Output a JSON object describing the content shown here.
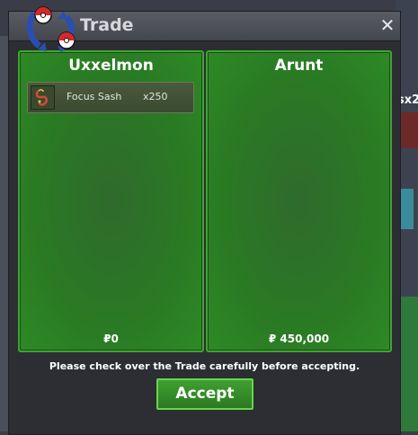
{
  "window": {
    "title": "Trade",
    "close_label": "✕"
  },
  "left_panel": {
    "name": "Uxxelmon",
    "items": [
      {
        "name": "Focus Sash",
        "quantity": "x250",
        "icon": "focus-sash-icon"
      }
    ],
    "money": "₽0"
  },
  "right_panel": {
    "name": "Arunt",
    "items": [],
    "money": "₽ 450,000"
  },
  "footer": {
    "notice": "Please check over the Trade carefully before accepting.",
    "accept_label": "Accept"
  },
  "background": {
    "partial_text": "sx2"
  },
  "colors": {
    "panel_green": "#2a7a24",
    "panel_border": "#3fa532",
    "window_bg": "#32343b"
  }
}
